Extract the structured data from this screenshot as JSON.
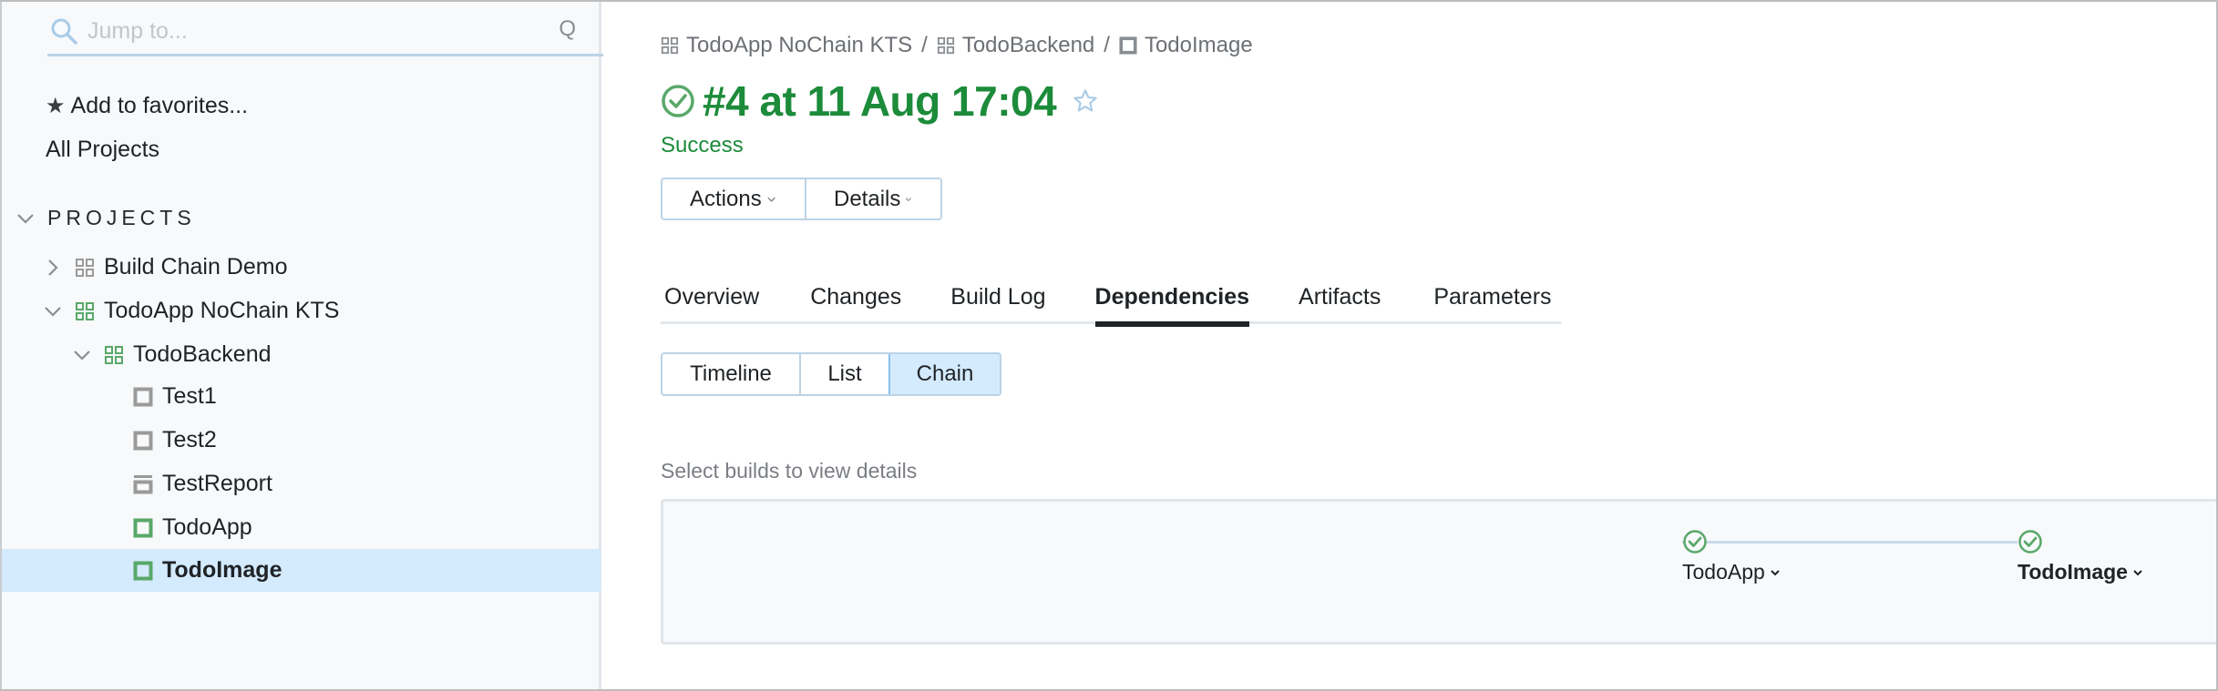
{
  "sidebar": {
    "search": {
      "placeholder": "Jump to...",
      "value": "",
      "shortcut": "Q",
      "icon": "search-icon"
    },
    "add_favorites": "Add to favorites...",
    "all_projects": "All Projects",
    "projects_header": "PROJECTS",
    "tree": [
      {
        "label": "Build Chain Demo",
        "type": "project",
        "expanded": false,
        "status": "neutral",
        "level": 0
      },
      {
        "label": "TodoApp NoChain KTS",
        "type": "project",
        "expanded": true,
        "status": "success",
        "level": 0
      },
      {
        "label": "TodoBackend",
        "type": "project",
        "expanded": true,
        "status": "success",
        "level": 1
      },
      {
        "label": "Test1",
        "type": "build-config",
        "status": "neutral",
        "level": 2
      },
      {
        "label": "Test2",
        "type": "build-config",
        "status": "neutral",
        "level": 2
      },
      {
        "label": "TestReport",
        "type": "composite-config",
        "status": "neutral",
        "level": 2
      },
      {
        "label": "TodoApp",
        "type": "build-config",
        "status": "success",
        "level": 2
      },
      {
        "label": "TodoImage",
        "type": "build-config",
        "status": "success",
        "level": 2,
        "selected": true
      }
    ]
  },
  "main": {
    "breadcrumb": [
      {
        "label": "TodoApp NoChain KTS",
        "icon": "project-icon"
      },
      {
        "label": "TodoBackend",
        "icon": "project-icon"
      },
      {
        "label": "TodoImage",
        "icon": "build-config-icon"
      }
    ],
    "breadcrumb_separator": "/",
    "title": "#4 at 11 Aug 17:04",
    "status": "Success",
    "buttons": {
      "actions": "Actions",
      "details": "Details"
    },
    "tabs": [
      {
        "label": "Overview"
      },
      {
        "label": "Changes"
      },
      {
        "label": "Build Log"
      },
      {
        "label": "Dependencies",
        "active": true
      },
      {
        "label": "Artifacts"
      },
      {
        "label": "Parameters"
      }
    ],
    "view_modes": [
      {
        "label": "Timeline"
      },
      {
        "label": "List"
      },
      {
        "label": "Chain",
        "active": true
      }
    ],
    "hint": "Select builds to view details",
    "chain": {
      "nodes": [
        {
          "label": "TodoApp",
          "status": "success",
          "current": false
        },
        {
          "label": "TodoImage",
          "status": "success",
          "current": true
        }
      ]
    }
  },
  "colors": {
    "success": "#1c8b3a",
    "success_icon": "#59a869",
    "selected_bg": "#d4eafd",
    "border_accent": "#bcd3e6",
    "sidebar_bg": "#f7f9fb",
    "neutral_icon": "#9a9a9a"
  }
}
